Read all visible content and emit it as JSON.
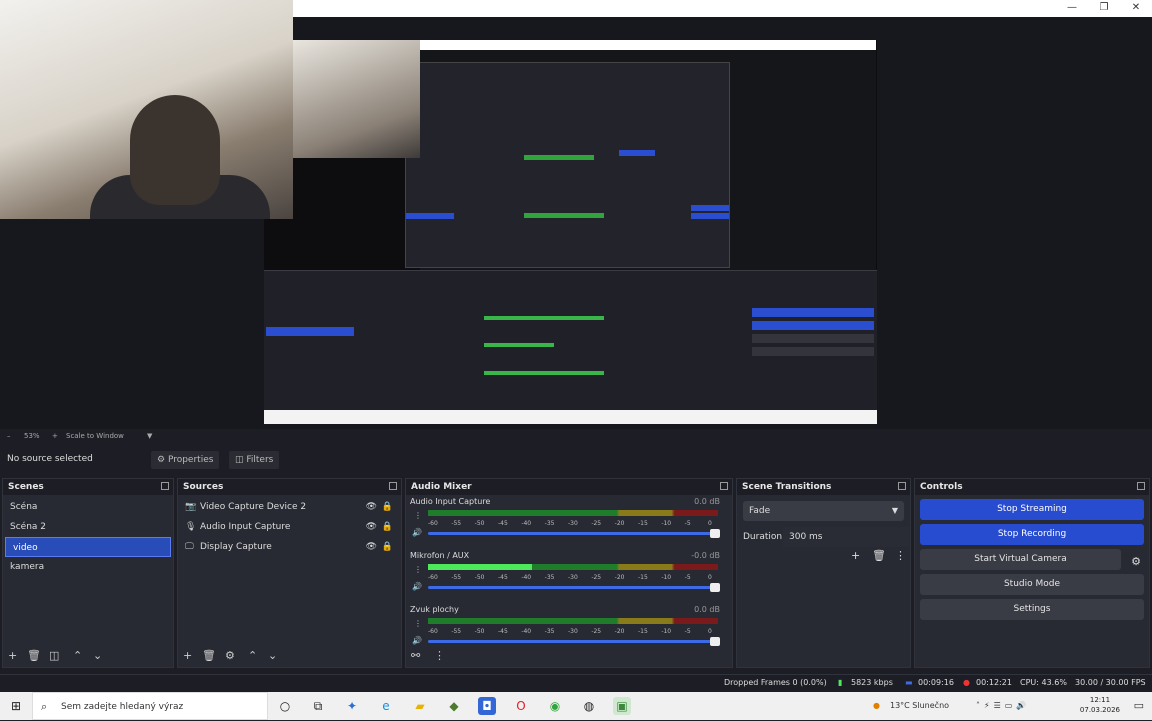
{
  "window": {
    "minimize": "—",
    "restore": "❐",
    "close": "✕"
  },
  "preview": {
    "zoom": "53%",
    "scale_mode": "Scale to Window"
  },
  "source_toolbar": {
    "status": "No source selected",
    "properties": "Properties",
    "filters": "Filters"
  },
  "scenes": {
    "title": "Scenes",
    "items": [
      "Scéna",
      "Scéna 2",
      "video",
      "kamera"
    ],
    "selected": "video"
  },
  "sources": {
    "title": "Sources",
    "items": [
      {
        "name": "Video Capture Device 2",
        "icon": "camera-icon"
      },
      {
        "name": "Audio Input Capture",
        "icon": "microphone-icon"
      },
      {
        "name": "Display Capture",
        "icon": "monitor-icon"
      }
    ]
  },
  "audio_mixer": {
    "title": "Audio Mixer",
    "channels": [
      {
        "name": "Audio Input Capture",
        "db": "0.0 dB",
        "level": 0.0
      },
      {
        "name": "Mikrofon / AUX",
        "db": "-0.0 dB",
        "level": 0.36
      },
      {
        "name": "Zvuk plochy",
        "db": "0.0 dB",
        "level": 0.0
      }
    ],
    "ticks": [
      "-60",
      "-55",
      "-50",
      "-45",
      "-40",
      "-35",
      "-30",
      "-25",
      "-20",
      "-15",
      "-10",
      "-5",
      "0"
    ]
  },
  "scene_transitions": {
    "title": "Scene Transitions",
    "transition": "Fade",
    "duration_label": "Duration",
    "duration_value": "300 ms"
  },
  "controls": {
    "title": "Controls",
    "stop_streaming": "Stop Streaming",
    "stop_recording": "Stop Recording",
    "start_virtual_camera": "Start Virtual Camera",
    "studio_mode": "Studio Mode",
    "settings": "Settings"
  },
  "status": {
    "dropped_frames": "Dropped Frames 0 (0.0%)",
    "bitrate": "5823 kbps",
    "stream_time": "00:09:16",
    "record_time": "00:12:21",
    "cpu": "CPU: 43.6%",
    "fps": "30.00 / 30.00 FPS"
  },
  "taskbar": {
    "search_placeholder": "Sem zadejte hledaný výraz",
    "weather": "13°C  Slunečno",
    "time": "12:11",
    "date": "07.03.2026"
  },
  "colors": {
    "accent": "#284cd0",
    "panel": "#272a33",
    "background": "#1d1e25"
  }
}
